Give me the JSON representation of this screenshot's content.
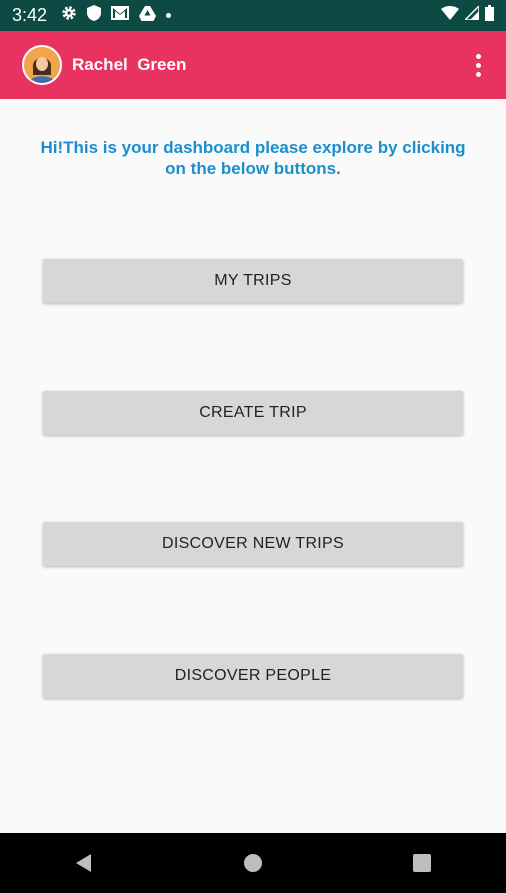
{
  "status_bar": {
    "time": "3:42",
    "left_icons": [
      "gear-icon",
      "shield-icon",
      "gmail-icon",
      "drive-icon"
    ],
    "right_icons": [
      "wifi-icon",
      "signal-icon",
      "battery-icon"
    ]
  },
  "app_bar": {
    "user_name": "Rachel  Green",
    "avatar": "avatar-icon",
    "menu_icon": "overflow-menu-icon"
  },
  "main": {
    "welcome_text": "Hi!This is your dashboard please explore by clicking on the below buttons.",
    "buttons": [
      {
        "label": "MY TRIPS"
      },
      {
        "label": "CREATE TRIP"
      },
      {
        "label": "DISCOVER NEW TRIPS"
      },
      {
        "label": "DISCOVER PEOPLE"
      }
    ]
  },
  "nav_bar": {
    "items": [
      "back-icon",
      "home-icon",
      "recents-icon"
    ]
  },
  "colors": {
    "status_bar": "#0e4a44",
    "app_bar": "#e8325f",
    "welcome_text": "#1a8fce",
    "button_bg": "#d7d7d7"
  }
}
